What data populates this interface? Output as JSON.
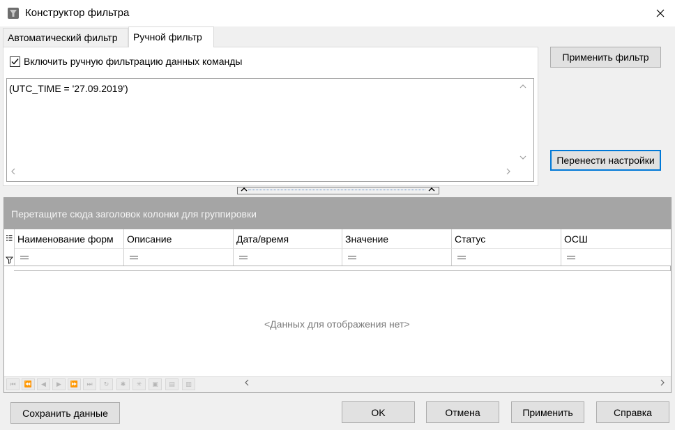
{
  "window": {
    "title": "Конструктор фильтра"
  },
  "tabs": [
    {
      "label": "Автоматический фильтр",
      "active": false
    },
    {
      "label": "Ручной фильтр",
      "active": true
    }
  ],
  "manual_filter": {
    "enable_label": "Включить ручную фильтрацию данных команды",
    "enabled": true,
    "expression": "(UTC_TIME = '27.09.2019')"
  },
  "buttons": {
    "apply_filter": "Применить фильтр",
    "transfer_settings": "Перенести настройки",
    "save_data": "Сохранить данные",
    "ok": "OK",
    "cancel": "Отмена",
    "apply": "Применить",
    "help": "Справка"
  },
  "grid": {
    "group_panel_text": "Перетащите сюда заголовок колонки для группировки",
    "columns": [
      "Наименование форм",
      "Описание",
      "Дата/время",
      "Значение",
      "Статус",
      "ОСШ"
    ],
    "empty_text": "<Данных для отображения нет>"
  },
  "icons": {
    "app": "filter-app-icon",
    "close": "close-icon"
  }
}
